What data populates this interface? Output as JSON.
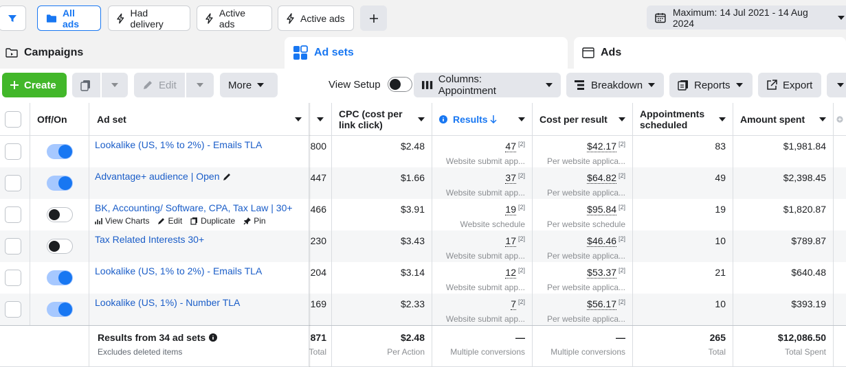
{
  "filters": {
    "all_ads": "All ads",
    "had_delivery": "Had delivery",
    "active_ads_1": "Active ads",
    "active_ads_2": "Active ads",
    "date_range": "Maximum: 14 Jul 2021 - 14 Aug 2024"
  },
  "tabs": {
    "campaigns": "Campaigns",
    "ad_sets": "Ad sets",
    "ads": "Ads"
  },
  "toolbar": {
    "create": "Create",
    "edit": "Edit",
    "more": "More",
    "view_setup": "View Setup",
    "columns": "Columns: Appointment",
    "breakdown": "Breakdown",
    "reports": "Reports",
    "export": "Export"
  },
  "colors": {
    "accent": "#1877f2",
    "create": "#42b72a",
    "link": "#1a5dc8"
  },
  "table": {
    "headers": {
      "off_on": "Off/On",
      "ad_set": "Ad set",
      "cpc": "CPC (cost per link click)",
      "results": "Results",
      "cost_per_result": "Cost per result",
      "appointments": "Appointments scheduled",
      "amount_spent": "Amount spent"
    },
    "rows": [
      {
        "name": "Lookalike (US, 1% to 2%) - Emails TLA",
        "on": true,
        "prev": "800",
        "cpc": "$2.48",
        "results": "47",
        "results_sup": "[2]",
        "results_sub": "Website submit app...",
        "cpr": "$42.17",
        "cpr_sup": "[2]",
        "cpr_sub": "Per website applica...",
        "appts": "83",
        "spent": "$1,981.84"
      },
      {
        "name": "Advantage+ audience | Open",
        "on": true,
        "prev": "447",
        "cpc": "$1.66",
        "results": "37",
        "results_sup": "[2]",
        "results_sub": "Website submit app...",
        "cpr": "$64.82",
        "cpr_sup": "[2]",
        "cpr_sub": "Per website applica...",
        "appts": "49",
        "spent": "$2,398.45"
      },
      {
        "name": "BK, Accounting/ Software, CPA, Tax Law | 30+",
        "on": false,
        "prev": "466",
        "cpc": "$3.91",
        "results": "19",
        "results_sup": "[2]",
        "results_sub": "Website schedule",
        "cpr": "$95.84",
        "cpr_sup": "[2]",
        "cpr_sub": "Per website schedule",
        "appts": "19",
        "spent": "$1,820.87"
      },
      {
        "name": "Tax Related Interests 30+",
        "on": false,
        "prev": "230",
        "cpc": "$3.43",
        "results": "17",
        "results_sup": "[2]",
        "results_sub": "Website submit app...",
        "cpr": "$46.46",
        "cpr_sup": "[2]",
        "cpr_sub": "Per website applica...",
        "appts": "10",
        "spent": "$789.87"
      },
      {
        "name": "Lookalike (US, 1% to 2%) - Emails TLA",
        "on": true,
        "prev": "204",
        "cpc": "$3.14",
        "results": "12",
        "results_sup": "[2]",
        "results_sub": "Website submit app...",
        "cpr": "$53.37",
        "cpr_sup": "[2]",
        "cpr_sub": "Per website applica...",
        "appts": "21",
        "spent": "$640.48"
      },
      {
        "name": "Lookalike (US, 1%) - Number TLA",
        "on": true,
        "prev": "169",
        "cpc": "$2.33",
        "results": "7",
        "results_sup": "[2]",
        "results_sub": "Website submit app...",
        "cpr": "$56.17",
        "cpr_sup": "[2]",
        "cpr_sub": "Per website applica...",
        "appts": "10",
        "spent": "$393.19"
      }
    ],
    "row_actions": {
      "view_charts": "View Charts",
      "edit": "Edit",
      "duplicate": "Duplicate",
      "pin": "Pin"
    },
    "summary": {
      "title": "Results from 34 ad sets",
      "subtitle": "Excludes deleted items",
      "prev": "871",
      "prev_sub": "Total",
      "cpc": "$2.48",
      "cpc_sub": "Per Action",
      "results": "—",
      "results_sub": "Multiple conversions",
      "cpr": "—",
      "cpr_sub": "Multiple conversions",
      "appts": "265",
      "appts_sub": "Total",
      "spent": "$12,086.50",
      "spent_sub": "Total Spent"
    }
  }
}
